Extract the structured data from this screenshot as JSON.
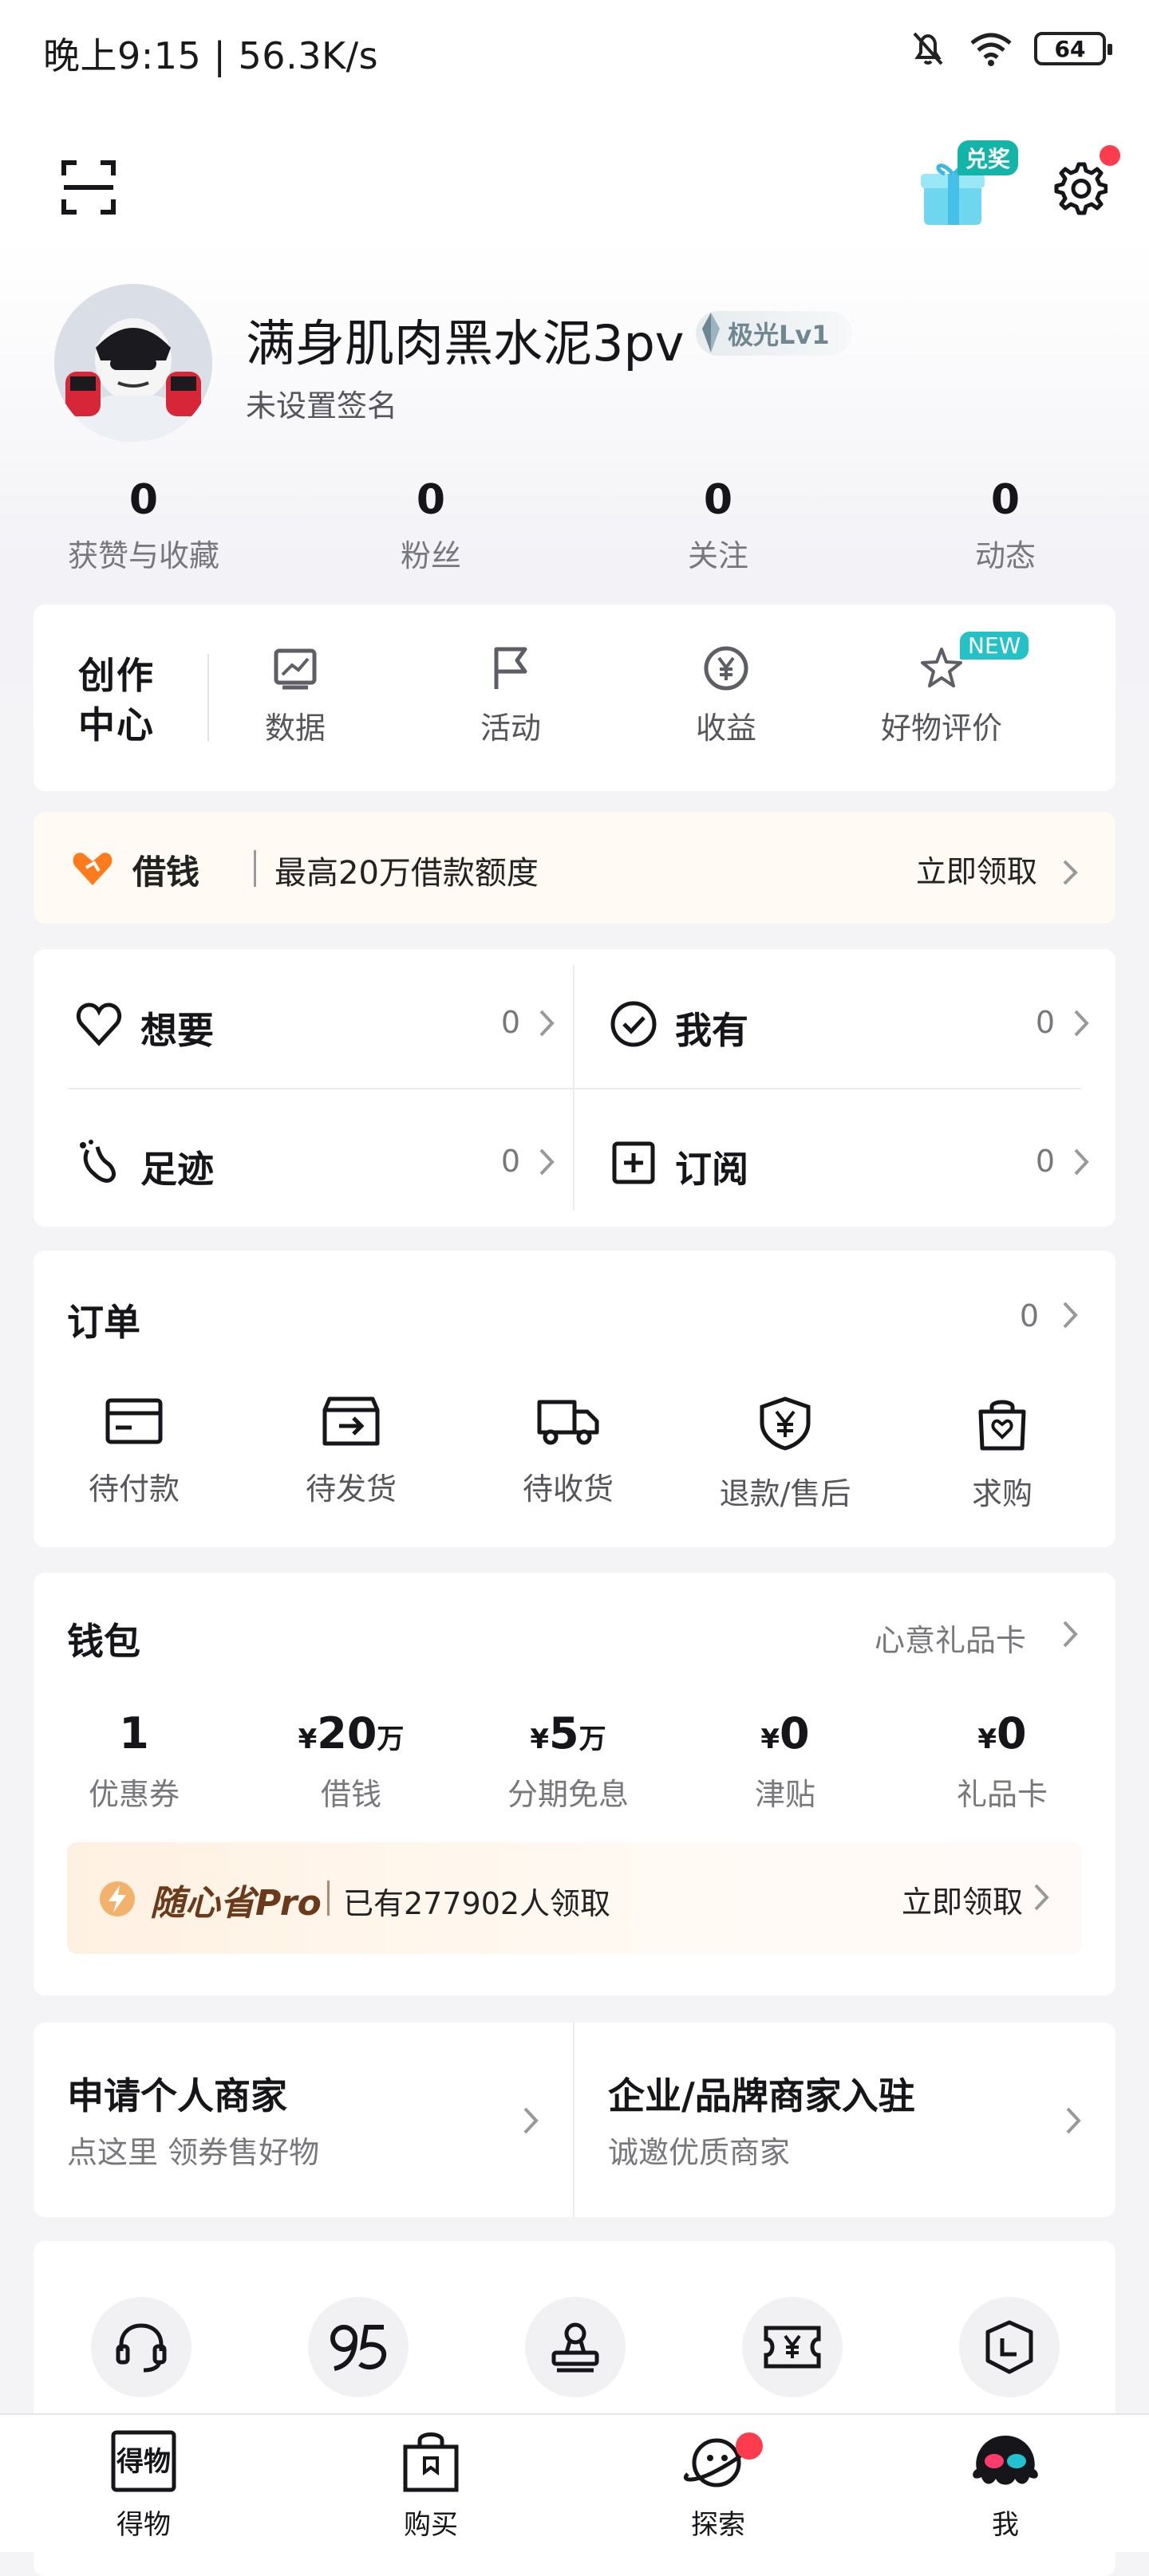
{
  "status_bar": {
    "time_speed": "晚上9:15 | 56.3K/s",
    "battery": "64"
  },
  "header": {
    "gift_badge": "兑奖"
  },
  "profile": {
    "nickname": "满身肌肉黑水泥3pv",
    "level": "极光Lv1",
    "signature": "未设置签名",
    "stats": [
      {
        "value": "0",
        "label": "获赞与收藏"
      },
      {
        "value": "0",
        "label": "粉丝"
      },
      {
        "value": "0",
        "label": "关注"
      },
      {
        "value": "0",
        "label": "动态"
      }
    ]
  },
  "creator_center": {
    "title": "创作\n中心",
    "items": [
      {
        "label": "数据",
        "icon": "chart-icon"
      },
      {
        "label": "活动",
        "icon": "flag-icon"
      },
      {
        "label": "收益",
        "icon": "yuan-coin-icon"
      },
      {
        "label": "好物评价",
        "icon": "star-icon"
      }
    ],
    "new_badge": "NEW"
  },
  "loan_banner": {
    "label": "借钱",
    "desc": "最高20万借款额度",
    "cta": "立即领取"
  },
  "collections": [
    {
      "name": "想要",
      "count": "0",
      "icon": "heart-icon"
    },
    {
      "name": "我有",
      "count": "0",
      "icon": "check-circle-icon"
    },
    {
      "name": "足迹",
      "count": "0",
      "icon": "footprint-icon"
    },
    {
      "name": "订阅",
      "count": "0",
      "icon": "plus-square-icon"
    }
  ],
  "orders": {
    "title": "订单",
    "count": "0",
    "items": [
      {
        "label": "待付款",
        "icon": "card-icon"
      },
      {
        "label": "待发货",
        "icon": "box-icon"
      },
      {
        "label": "待收货",
        "icon": "truck-icon"
      },
      {
        "label": "退款/售后",
        "icon": "shield-yuan-icon"
      },
      {
        "label": "求购",
        "icon": "bag-heart-icon"
      }
    ]
  },
  "wallet": {
    "title": "钱包",
    "gift_card_link": "心意礼品卡",
    "items": [
      {
        "value": "1",
        "unit": "",
        "prefix": "",
        "label": "优惠券"
      },
      {
        "value": "20",
        "unit": "万",
        "prefix": "¥",
        "label": "借钱"
      },
      {
        "value": "5",
        "unit": "万",
        "prefix": "¥",
        "label": "分期免息"
      },
      {
        "value": "0",
        "unit": "",
        "prefix": "¥",
        "label": "津贴"
      },
      {
        "value": "0",
        "unit": "",
        "prefix": "¥",
        "label": "礼品卡"
      }
    ],
    "promo": {
      "brand": "随心省Pro",
      "desc": "已有277902人领取",
      "cta": "立即领取"
    }
  },
  "merchant": [
    {
      "title": "申请个人商家",
      "sub": "点这里 领券售好物"
    },
    {
      "title": "企业/品牌商家入驻",
      "sub": "诚邀优质商家"
    }
  ],
  "tools": [
    {
      "icon": "headset-icon"
    },
    {
      "icon": "95-icon"
    },
    {
      "icon": "stamp-icon"
    },
    {
      "icon": "ticket-yuan-icon"
    },
    {
      "icon": "shield-clock-icon"
    }
  ],
  "tabbar": [
    {
      "label": "得物",
      "icon": "dewu-logo-icon"
    },
    {
      "label": "购买",
      "icon": "shopping-bag-icon"
    },
    {
      "label": "探索",
      "icon": "planet-icon"
    },
    {
      "label": "我",
      "icon": "octopus-icon"
    }
  ],
  "colors": {
    "accent_teal": "#12b5a8",
    "alert_red": "#ff3b4e",
    "loan_orange": "#ff7a1a"
  }
}
